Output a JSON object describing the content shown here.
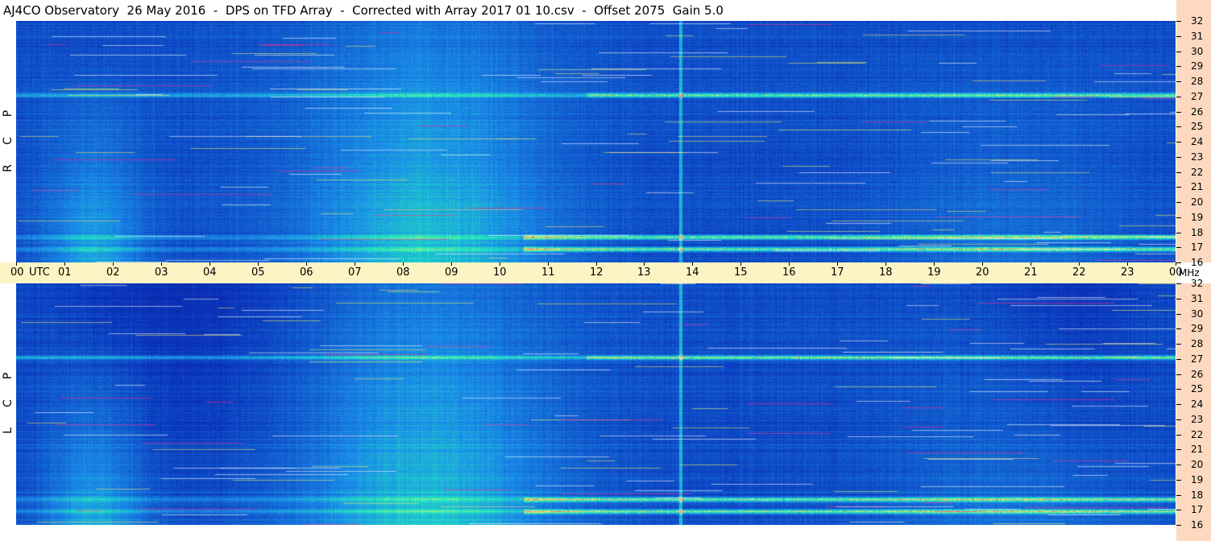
{
  "header": {
    "title": "AJ4CO Observatory  26 May 2016  -  DPS on TFD Array  -  Corrected with Array 2017 01 10.csv  -  Offset 2075  Gain 5.0"
  },
  "panels": {
    "top_letters": [
      "P",
      "C",
      "R"
    ],
    "bottom_letters": [
      "P",
      "C",
      "L"
    ]
  },
  "chart_data": {
    "type": "heatmap",
    "title": "AJ4CO Observatory  26 May 2016  -  DPS on TFD Array  -  Corrected with Array 2017 01 10.csv  -  Offset 2075  Gain 5.0",
    "x_label": "UTC",
    "x_ticks": [
      "00",
      "01",
      "02",
      "03",
      "04",
      "05",
      "06",
      "07",
      "08",
      "09",
      "10",
      "11",
      "12",
      "13",
      "14",
      "15",
      "16",
      "17",
      "18",
      "19",
      "20",
      "21",
      "22",
      "23",
      "00"
    ],
    "x_range_hours": [
      0,
      24
    ],
    "y_unit": "MHz",
    "y_ticks": [
      "32",
      "31",
      "30",
      "29",
      "28",
      "27",
      "26",
      "25",
      "24",
      "23",
      "22",
      "21",
      "20",
      "19",
      "18",
      "17",
      "16"
    ],
    "y_range_mhz": [
      16,
      32
    ],
    "panels": [
      "RCP",
      "LCP"
    ],
    "hot_bands_mhz": [
      27.1,
      17.7,
      16.9
    ],
    "colors": {
      "low": "#0a30b8",
      "mid": "#1a8ce8",
      "high": "#22e8c0",
      "hot1": "#f0f060",
      "hot2": "#ff3090",
      "max": "#ffffff"
    }
  }
}
